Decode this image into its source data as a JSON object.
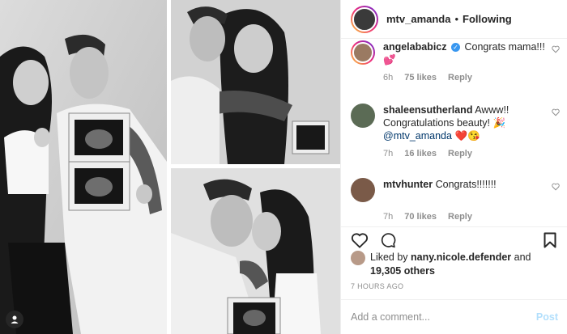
{
  "post": {
    "author": "mtv_amanda",
    "separator": "•",
    "follow_status": "Following",
    "liked_by_prefix": "Liked by",
    "liked_by_user": "nany.nicole.defender",
    "liked_by_and": "and",
    "liked_by_others": "19,305 others",
    "timestamp": "7 HOURS AGO"
  },
  "comments": [
    {
      "username": "angelababicz",
      "verified": true,
      "text": "Congrats mama!!!",
      "emoji": "💕",
      "age": "6h",
      "likes": "75 likes",
      "reply": "Reply"
    },
    {
      "username": "shaleensutherland",
      "verified": false,
      "text": "Awww!! Congratulations beauty!",
      "emoji_1": "🎉",
      "mention": "@mtv_amanda",
      "emoji_2": "❤️😘",
      "age": "7h",
      "likes": "16 likes",
      "reply": "Reply"
    },
    {
      "username": "mtvhunter",
      "verified": false,
      "text": "Congrats!!!!!!!",
      "age": "7h",
      "likes": "70 likes",
      "reply": "Reply"
    }
  ],
  "add_comment": {
    "placeholder": "Add a comment...",
    "post_label": "Post"
  },
  "icons": {
    "like": "heart-icon",
    "comment": "comment-icon",
    "save": "bookmark-icon",
    "comment_like": "small-heart-icon",
    "verified": "verified-badge-icon",
    "photo_profile": "user-silhouette-icon"
  },
  "colors": {
    "verified": "#3897f0",
    "mention": "#00376b",
    "meta": "#8e8e8e",
    "post_disabled": "#b2dffc"
  }
}
